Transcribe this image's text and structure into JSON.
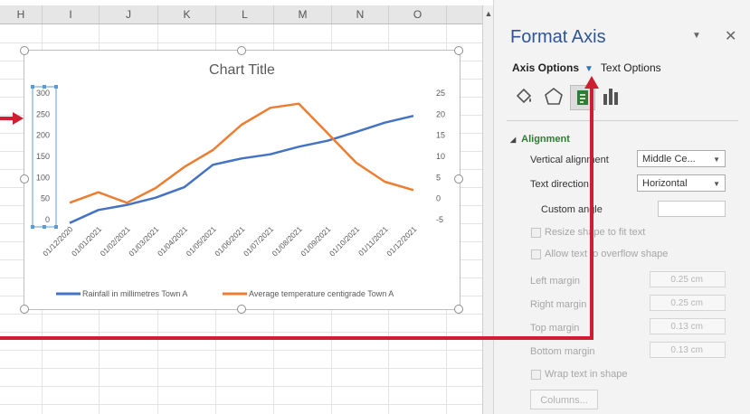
{
  "columns": [
    "H",
    "I",
    "J",
    "K",
    "L",
    "M",
    "N",
    "O"
  ],
  "chart": {
    "title": "Chart Title",
    "primary_axis_ticks": [
      "300",
      "250",
      "200",
      "150",
      "100",
      "50",
      "0"
    ],
    "secondary_axis_ticks": [
      "25",
      "20",
      "15",
      "10",
      "5",
      "0",
      "-5"
    ],
    "date_labels": [
      "01/12/2020",
      "01/01/2021",
      "01/02/2021",
      "01/03/2021",
      "01/04/2021",
      "01/05/2021",
      "01/06/2021",
      "01/07/2021",
      "01/08/2021",
      "01/09/2021",
      "01/10/2021",
      "01/11/2021",
      "01/12/2021"
    ],
    "legend": {
      "rainfall": "Rainfall in millimetres Town A",
      "temperature": "Average temperature centigrade Town A"
    }
  },
  "chart_data": {
    "type": "line",
    "title": "Chart Title",
    "x": [
      "01/12/2020",
      "01/01/2021",
      "01/02/2021",
      "01/03/2021",
      "01/04/2021",
      "01/05/2021",
      "01/06/2021",
      "01/07/2021",
      "01/08/2021",
      "01/09/2021",
      "01/10/2021",
      "01/11/2021",
      "01/12/2021"
    ],
    "ylim": [
      0,
      300
    ],
    "y2lim": [
      -5,
      25
    ],
    "series": [
      {
        "name": "Rainfall in millimetres Town A",
        "axis": "primary",
        "color": "#4472c4",
        "values": [
          -8,
          23,
          35,
          52,
          77,
          130,
          145,
          155,
          173,
          187,
          208,
          230,
          246
        ]
      },
      {
        "name": "Average temperature centigrade Town A",
        "axis": "secondary",
        "color": "#ed7d31",
        "values": [
          -1.0,
          1.5,
          -1.0,
          2.5,
          7.5,
          11.5,
          17.5,
          21.5,
          22.5,
          15.5,
          8.5,
          4.0,
          2.0
        ]
      }
    ],
    "legend_position": "bottom",
    "grid": false
  },
  "pane": {
    "title": "Format Axis",
    "menu_icon": "chevron-down-icon",
    "close_icon": "close-icon",
    "tab_axis": "Axis Options",
    "tab_text": "Text Options",
    "icons": [
      "fill-line-icon",
      "effects-icon",
      "size-properties-icon",
      "axis-options-icon"
    ],
    "section": "Alignment",
    "vertical_alignment_label": "Vertical alignment",
    "vertical_alignment_value": "Middle Ce...",
    "text_direction_label": "Text direction",
    "text_direction_value": "Horizontal",
    "custom_angle_label": "Custom angle",
    "custom_angle_value": "",
    "resize_shape": "Resize shape to fit text",
    "allow_overflow": "Allow text to overflow shape",
    "left_margin_label": "Left margin",
    "left_margin_value": "0.25 cm",
    "right_margin_label": "Right margin",
    "right_margin_value": "0.25 cm",
    "top_margin_label": "Top margin",
    "top_margin_value": "0.13 cm",
    "bottom_margin_label": "Bottom margin",
    "bottom_margin_value": "0.13 cm",
    "wrap_text": "Wrap text in shape",
    "columns_button": "Columns..."
  },
  "colors": {
    "annotation_arrow": "#cc1f2f",
    "rainfall": "#4472c4",
    "temperature": "#ed7d31",
    "selection": "#5b9bd5"
  }
}
